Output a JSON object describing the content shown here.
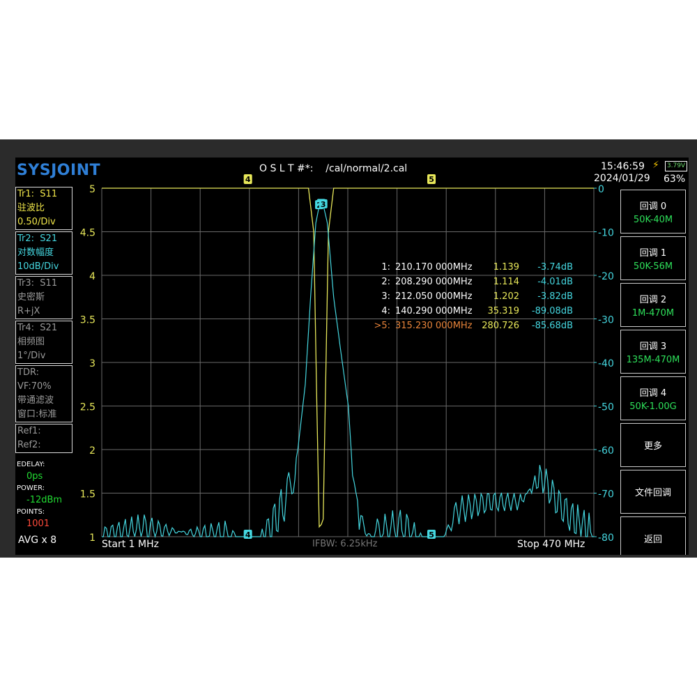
{
  "header": {
    "logo": "SYSJOINT",
    "cal_label": "O S L T #*:    /cal/normal/2.cal",
    "time": "15:46:59",
    "date": "2024/01/29",
    "battery_voltage": "3.79V",
    "battery_percent": "63%"
  },
  "traces": [
    {
      "name": "Tr1:",
      "param": "S11",
      "format": "驻波比",
      "scale": "0.50/Div"
    },
    {
      "name": "Tr2:",
      "param": "S21",
      "format": "对数幅度",
      "scale": "10dB/Div"
    },
    {
      "name": "Tr3:",
      "param": "S11",
      "format": "史密斯",
      "scale": "R+jX"
    },
    {
      "name": "Tr4:",
      "param": "S21",
      "format": "相频图",
      "scale": "1°/Div"
    }
  ],
  "tdr": {
    "title": "TDR:",
    "vf": "VF:70%",
    "filter": "带通滤波",
    "window": "窗口:标准"
  },
  "refs": {
    "ref1": "Ref1:",
    "ref2": "Ref2:"
  },
  "settings": {
    "edelay_label": "EDELAY:",
    "edelay_value": "0ps",
    "power_label": "POWER:",
    "power_value": "-12dBm",
    "points_label": "POINTS:",
    "points_value": "1001",
    "avg": "AVG x 8"
  },
  "markers": [
    {
      "id": "1:",
      "freq": "210.170 000MHz",
      "swr": "1.139",
      "db": "-3.74dB"
    },
    {
      "id": "2:",
      "freq": "208.290 000MHz",
      "swr": "1.114",
      "db": "-4.01dB"
    },
    {
      "id": "3:",
      "freq": "212.050 000MHz",
      "swr": "1.202",
      "db": "-3.82dB"
    },
    {
      "id": "4:",
      "freq": "140.290 000MHz",
      "swr": "35.319",
      "db": "-89.08dB"
    },
    {
      "id": ">5:",
      "freq": "315.230 000MHz",
      "swr": "280.726",
      "db": "-85.68dB"
    }
  ],
  "softkeys": [
    {
      "title": "回调 0",
      "range": "50K-40M"
    },
    {
      "title": "回调 1",
      "range": "50K-56M"
    },
    {
      "title": "回调 2",
      "range": "1M-470M"
    },
    {
      "title": "回调 3",
      "range": "135M-470M"
    },
    {
      "title": "回调 4",
      "range": "50K-1.00G"
    },
    {
      "title": "更多",
      "range": ""
    },
    {
      "title": "文件回调",
      "range": ""
    },
    {
      "title": "返回",
      "range": ""
    }
  ],
  "footer": {
    "start": "Start  1 MHz",
    "ifbw": "IFBW: 6.25kHz",
    "stop": "Stop  470 MHz"
  },
  "chart_data": {
    "type": "line",
    "x_unit": "MHz",
    "xlim": [
      1,
      470
    ],
    "left_axis": {
      "ticks": [
        "5",
        "4.5",
        "4",
        "3.5",
        "3",
        "2.5",
        "2",
        "1.5",
        "1"
      ],
      "ylim": [
        1,
        5
      ]
    },
    "right_axis": {
      "ticks": [
        "0",
        "-10",
        "-20",
        "-30",
        "-40",
        "-50",
        "-60",
        "-70",
        "-80"
      ],
      "ylim": [
        -80,
        0
      ]
    },
    "grid": true,
    "series": [
      {
        "color": "#e8e85a",
        "axis": "left",
        "x": [
          1,
          190,
          198,
          203,
          206,
          208.29,
          210.17,
          212.05,
          214,
          217,
          222,
          230,
          470
        ],
        "values": [
          5,
          5,
          5,
          4.5,
          2.5,
          1.114,
          1.139,
          1.202,
          2.5,
          4.5,
          5,
          5,
          5
        ]
      },
      {
        "color": "#45d7e0",
        "axis": "left_s21_db",
        "x": [
          1,
          40,
          80,
          120,
          140.29,
          160,
          175,
          185,
          195,
          200,
          205,
          208.29,
          210.17,
          212.05,
          216,
          222,
          228,
          232,
          236,
          240,
          248,
          255,
          265,
          290,
          315.23,
          340,
          370,
          400,
          420,
          435,
          450,
          470
        ],
        "values": [
          -80,
          -78,
          -79,
          -80,
          -89.08,
          -79,
          -72,
          -66,
          -45,
          -25,
          -8,
          -4.01,
          -3.74,
          -3.82,
          -8,
          -25,
          -36,
          -43,
          -50,
          -65,
          -78,
          -80,
          -80,
          -78,
          -85.68,
          -74,
          -72,
          -72,
          -66,
          -72,
          -76,
          -80
        ]
      }
    ],
    "marker_flags": [
      {
        "label": "1",
        "x": 210.17,
        "value": "-3.74dB"
      },
      {
        "label": "2",
        "x": 208.29,
        "value": "-4.01dB"
      },
      {
        "label": "3",
        "x": 212.05,
        "value": "-3.82dB"
      },
      {
        "label": "4",
        "x": 140.29,
        "value": "-89.08dB"
      },
      {
        "label": "5",
        "x": 315.23,
        "value": "-85.68dB"
      }
    ]
  }
}
